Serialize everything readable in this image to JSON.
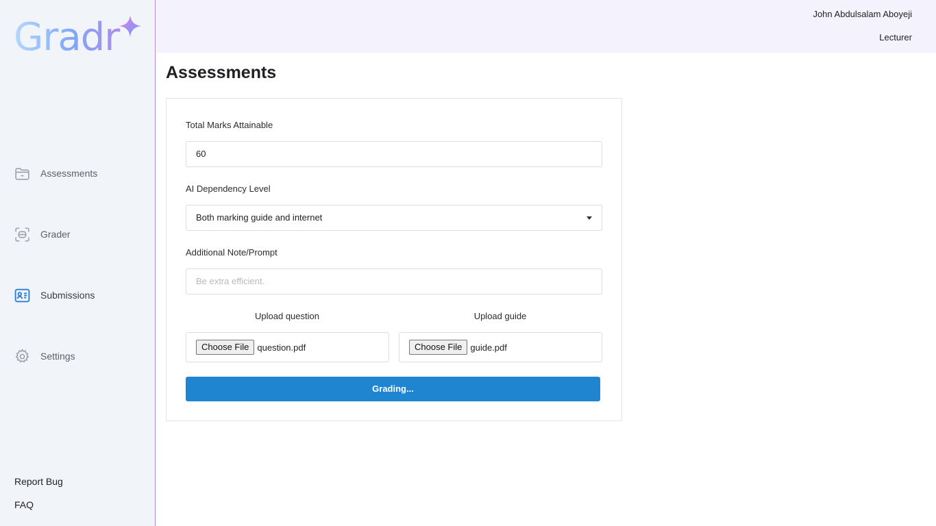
{
  "brand": {
    "name": "Gradr"
  },
  "user": {
    "name": "John Abdulsalam Aboyeji",
    "role": "Lecturer"
  },
  "sidebar": {
    "items": [
      {
        "label": "Assessments",
        "icon": "folder-icon"
      },
      {
        "label": "Grader",
        "icon": "scan-icon"
      },
      {
        "label": "Submissions",
        "icon": "id-card-icon",
        "active": true
      },
      {
        "label": "Settings",
        "icon": "gear-icon"
      }
    ],
    "footer": {
      "report_bug": "Report Bug",
      "faq": "FAQ"
    }
  },
  "page": {
    "title": "Assessments"
  },
  "form": {
    "total_marks": {
      "label": "Total Marks Attainable",
      "value": "60"
    },
    "ai_dependency": {
      "label": "AI Dependency Level",
      "selected": "Both marking guide and internet"
    },
    "note": {
      "label": "Additional Note/Prompt",
      "placeholder": "Be extra efficient."
    },
    "upload_question": {
      "label": "Upload question",
      "button": "Choose File",
      "file": "question.pdf"
    },
    "upload_guide": {
      "label": "Upload guide",
      "button": "Choose File",
      "file": "guide.pdf"
    },
    "submit": {
      "label": "Grading..."
    }
  },
  "colors": {
    "accent": "#2085d0",
    "sidebar_bg": "#f1f4f9",
    "topbar_bg": "#f3f2fd",
    "active_icon": "#2a7fd4"
  }
}
